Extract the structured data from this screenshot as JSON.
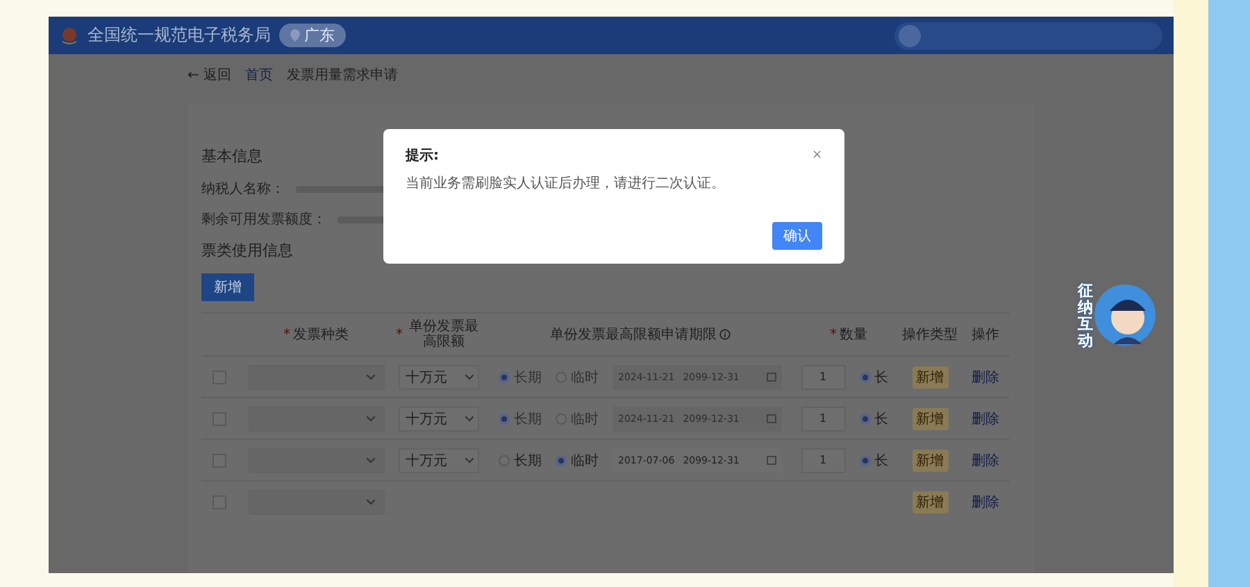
{
  "header": {
    "title": "全国统一规范电子税务局",
    "region": "广东"
  },
  "breadcrumb": {
    "back": "← 返回",
    "items": [
      "首页",
      "发票用量需求申请"
    ]
  },
  "basic_info": {
    "title": "基本信息",
    "fields": [
      {
        "label": "纳税人名称："
      },
      {
        "label": "剩余可用发票额度："
      }
    ]
  },
  "usage_info": {
    "title": "票类使用信息",
    "add_button": "新增",
    "table": {
      "columns": [
        {
          "marker": "*",
          "label": "发票种类"
        },
        {
          "marker": "*",
          "label": "单份发票最高限额"
        },
        {
          "label": "单份发票最高限额申请期限",
          "info": true
        },
        {
          "marker": "*",
          "label": "数量"
        },
        {
          "label": "操作类型"
        },
        {
          "label": "操作"
        }
      ],
      "rows": [
        {
          "checked": false,
          "limit": "十万元",
          "period": [
            {
              "label": "长期",
              "selected": true
            },
            {
              "label": "临时",
              "selected": false
            }
          ],
          "disabled": true,
          "start": "2024-11-21",
          "end": "2099-12-31",
          "quantity": "1",
          "extra": {
            "label": "长",
            "selected": true
          },
          "operation_type": "新增",
          "action": "删除"
        },
        {
          "checked": false,
          "limit": "十万元",
          "period": [
            {
              "label": "长期",
              "selected": true
            },
            {
              "label": "临时",
              "selected": false
            }
          ],
          "disabled": true,
          "start": "2024-11-21",
          "end": "2099-12-31",
          "quantity": "1",
          "extra": {
            "label": "长",
            "selected": true
          },
          "operation_type": "新增",
          "action": "删除"
        },
        {
          "checked": false,
          "limit": "十万元",
          "period": [
            {
              "label": "长期",
              "selected": false
            },
            {
              "label": "临时",
              "selected": true
            }
          ],
          "disabled": false,
          "start": "2017-07-06",
          "end": "2099-12-31",
          "quantity": "1",
          "extra": {
            "label": "长",
            "selected": true
          },
          "operation_type": "新增",
          "action": "删除"
        },
        {
          "checked": false,
          "operation_type": "新增",
          "action": "删除"
        }
      ]
    }
  },
  "dialog": {
    "title": "提示:",
    "close": "×",
    "message": "当前业务需刷脸实人认证后办理，请进行二次认证。",
    "confirm": "确认"
  },
  "assistant": {
    "label": "征纳互动"
  }
}
